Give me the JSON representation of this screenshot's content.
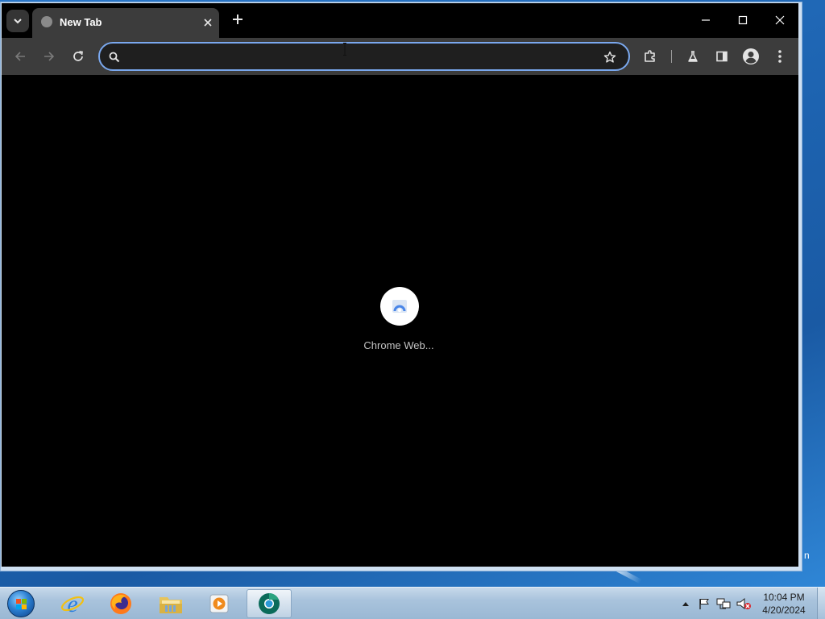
{
  "browser": {
    "tab": {
      "title": "New Tab"
    },
    "omnibox": {
      "value": "",
      "placeholder": ""
    },
    "content": {
      "loading_label": "Chrome Web..."
    }
  },
  "taskbar": {
    "clock": {
      "time": "10:04 PM",
      "date": "4/20/2024"
    },
    "apps": [
      "internet-explorer",
      "firefox",
      "windows-explorer",
      "media-player",
      "chrome-dev"
    ]
  },
  "desktop": {
    "edge_text": "n"
  },
  "colors": {
    "browser_frame": "#000000",
    "toolbar": "#3c3c3c",
    "omnibox_focus_ring": "#7aa8ee",
    "taskbar": "#a9c3dc"
  }
}
